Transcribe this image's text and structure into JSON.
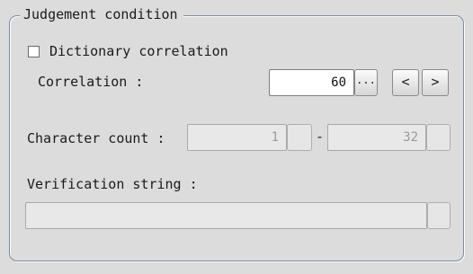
{
  "group": {
    "title": "Judgement condition"
  },
  "dictionary": {
    "label": "Dictionary correlation",
    "checked": false
  },
  "correlation": {
    "label": "Correlation :",
    "value": "60",
    "ellipsis": "...",
    "prev": "<",
    "next": ">"
  },
  "character_count": {
    "label": "Character count :",
    "min": "1",
    "separator": "-",
    "max": "32"
  },
  "verification": {
    "label": "Verification string :",
    "value": ""
  }
}
